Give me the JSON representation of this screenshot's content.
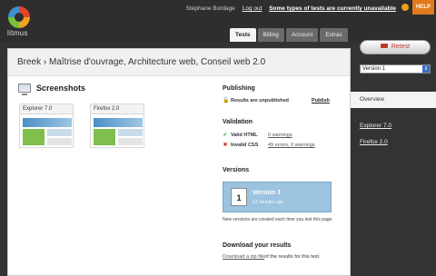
{
  "app": {
    "name": "litmus"
  },
  "topbar": {
    "user": "Stéphane Bordage",
    "logout": "Log out",
    "warning": "Some types of tests are currently unavailable",
    "help": "HELP"
  },
  "tabs": [
    {
      "label": "Tests",
      "active": true
    },
    {
      "label": "Billing",
      "active": false
    },
    {
      "label": "Account",
      "active": false
    },
    {
      "label": "Extras",
      "active": false
    }
  ],
  "page": {
    "title": "Breek › Maîtrise d'ouvrage, Architecture web, Conseil web 2.0"
  },
  "screenshots": {
    "heading": "Screenshots",
    "items": [
      {
        "browser": "Explorer 7.0"
      },
      {
        "browser": "Firefox 2.0"
      }
    ]
  },
  "publishing": {
    "heading": "Publishing",
    "status": "Results are unpublished",
    "action": "Publish"
  },
  "validation": {
    "heading": "Validation",
    "html": {
      "label": "Valid HTML",
      "detail": "0 warnings",
      "ok": true
    },
    "css": {
      "label": "Invalid CSS",
      "detail": "49 errors, 0 warnings",
      "ok": false
    }
  },
  "versions": {
    "heading": "Versions",
    "current": {
      "number": "1",
      "title": "Version 1",
      "time": "13 minutes ago"
    },
    "note": "New versions are created each time you test this page."
  },
  "download": {
    "heading": "Download your results",
    "link": "Download a zip file",
    "suffix": " of the results for this test."
  },
  "sidebar": {
    "retest": "Retest",
    "version_select": "Version 1",
    "overview": "Overview",
    "links": [
      "Explorer 7.0",
      "Firefox 2.0"
    ]
  }
}
